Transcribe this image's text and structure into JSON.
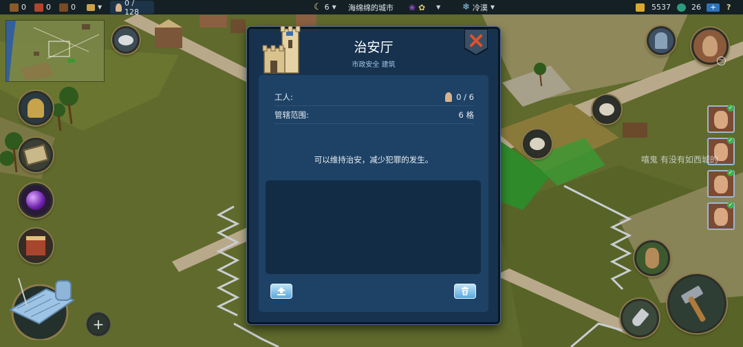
{
  "topbar": {
    "resources": [
      {
        "icon": "crate-icon",
        "value": "0",
        "color": "#8a5a2b"
      },
      {
        "icon": "brick-icon",
        "value": "0",
        "color": "#b0442c"
      },
      {
        "icon": "log-icon",
        "value": "0",
        "color": "#7a4a24"
      }
    ],
    "population": "0 / 128",
    "moon_count": "6",
    "city_name": "海绵绵的城市",
    "climate": "冷漠",
    "gold": "5537",
    "gems": "26",
    "add_label": "+",
    "help_label": "?"
  },
  "dialog": {
    "title": "治安厅",
    "subtitle": "市政安全 建筑",
    "workers_label": "工人:",
    "workers_value": "0 / 6",
    "range_label": "管辖范围:",
    "range_value": "6 格",
    "description": "可以维持治安，减少犯罪的发生。"
  },
  "chat_overlay": "嘻鬼  有没有如西城的",
  "plus_label": "+",
  "colors": {
    "dialog_bg": "#17324f",
    "panel_bg": "#1e4266",
    "grass": "#5f6a2c",
    "road": "#b9a98b",
    "accent_blue": "#5aa8dc",
    "close_red": "#e0522a"
  }
}
